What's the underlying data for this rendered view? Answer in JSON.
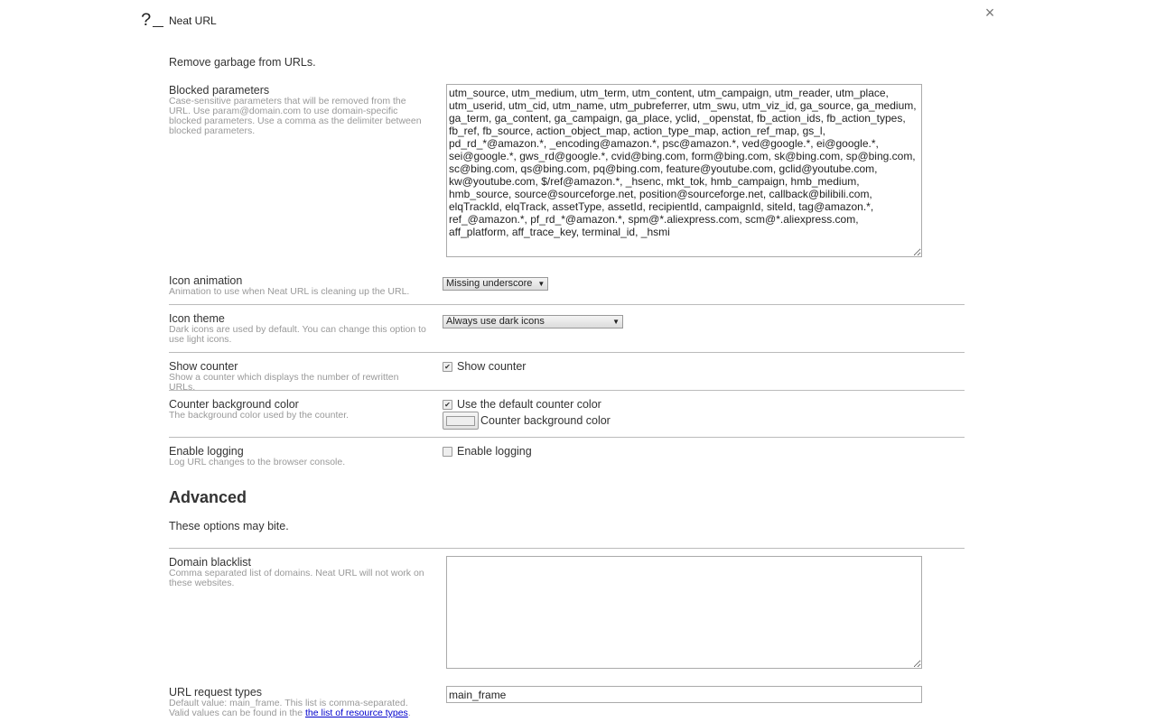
{
  "header": {
    "logo": "?_",
    "title": "Neat URL",
    "close_icon": "×"
  },
  "intro": "Remove garbage from URLs.",
  "settings": {
    "blocked_parameters": {
      "label": "Blocked parameters",
      "description": "Case-sensitive parameters that will be removed from the URL. Use param@domain.com to use domain-specific blocked parameters. Use a comma as the delimiter between blocked parameters.",
      "value": "utm_source, utm_medium, utm_term, utm_content, utm_campaign, utm_reader, utm_place, utm_userid, utm_cid, utm_name, utm_pubreferrer, utm_swu, utm_viz_id, ga_source, ga_medium, ga_term, ga_content, ga_campaign, ga_place, yclid, _openstat, fb_action_ids, fb_action_types, fb_ref, fb_source, action_object_map, action_type_map, action_ref_map, gs_l, pd_rd_*@amazon.*, _encoding@amazon.*, psc@amazon.*, ved@google.*, ei@google.*, sei@google.*, gws_rd@google.*, cvid@bing.com, form@bing.com, sk@bing.com, sp@bing.com, sc@bing.com, qs@bing.com, pq@bing.com, feature@youtube.com, gclid@youtube.com, kw@youtube.com, $/ref@amazon.*, _hsenc, mkt_tok, hmb_campaign, hmb_medium, hmb_source, source@sourceforge.net, position@sourceforge.net, callback@bilibili.com, elqTrackId, elqTrack, assetType, assetId, recipientId, campaignId, siteId, tag@amazon.*, ref_@amazon.*, pf_rd_*@amazon.*, spm@*.aliexpress.com, scm@*.aliexpress.com, aff_platform, aff_trace_key, terminal_id, _hsmi"
    },
    "icon_animation": {
      "label": "Icon animation",
      "description": "Animation to use when Neat URL is cleaning up the URL.",
      "selected": "Missing underscore"
    },
    "icon_theme": {
      "label": "Icon theme",
      "description": "Dark icons are used by default. You can change this option to use light icons.",
      "selected": "Always use dark icons"
    },
    "show_counter": {
      "label": "Show counter",
      "description": "Show a counter which displays the number of rewritten URLs.",
      "checkbox_label": "Show counter",
      "checked": true
    },
    "counter_bg": {
      "label": "Counter background color",
      "description": "The background color used by the counter.",
      "checkbox_label": "Use the default counter color",
      "checked": true,
      "color_label": "Counter background color"
    },
    "logging": {
      "label": "Enable logging",
      "description": "Log URL changes to the browser console.",
      "checkbox_label": "Enable logging",
      "checked": false
    }
  },
  "advanced": {
    "heading": "Advanced",
    "description": "These options may bite.",
    "domain_blacklist": {
      "label": "Domain blacklist",
      "description": "Comma separated list of domains. Neat URL will not work on these websites.",
      "value": ""
    },
    "request_types": {
      "label": "URL request types",
      "description_prefix": "Default value: main_frame. This list is comma-separated. Valid values can be found in the ",
      "link_text": "the list of resource types",
      "description_suffix": ".",
      "value": "main_frame"
    }
  }
}
